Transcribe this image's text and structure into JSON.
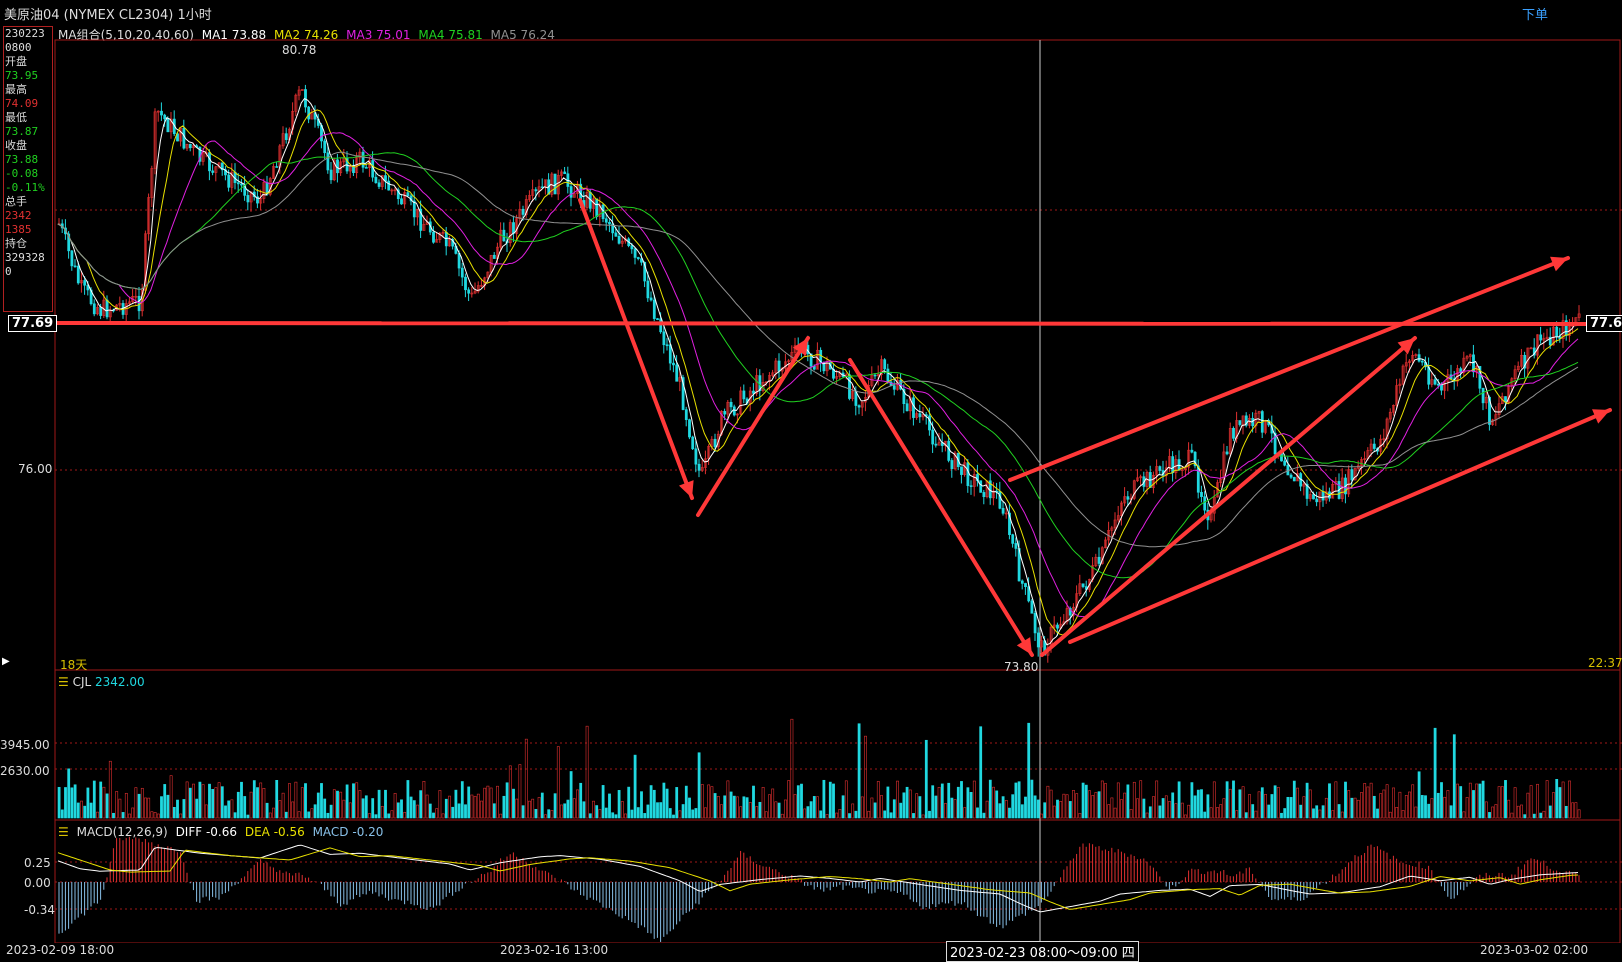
{
  "header": {
    "title": "美原油04 (NYMEX CL2304) 1小时",
    "order_button": "下单"
  },
  "info_panel": {
    "date": "230223",
    "time": "0800",
    "open_label": "开盘",
    "open_value": "73.95",
    "high_label": "最高",
    "high_value": "74.09",
    "low_label": "最低",
    "low_value": "73.87",
    "close_label": "收盘",
    "close_value": "73.88",
    "change": "-0.08",
    "change_pct": "-0.11%",
    "total_label": "总手",
    "total_value": "2342",
    "total_value2": "1385",
    "oi_label": "持仓",
    "oi_value": "329328",
    "oi_value2": "0"
  },
  "ma_legend": {
    "title": "MA组合(5,10,20,40,60)",
    "ma1": "MA1 73.88",
    "ma2": "MA2 74.26",
    "ma3": "MA3 75.01",
    "ma4": "MA4 75.81",
    "ma5": "MA5 76.24"
  },
  "colors": {
    "up": "#e03030",
    "down": "#20d8e0",
    "ma1": "#ffffff",
    "ma2": "#e8e000",
    "ma3": "#e020e0",
    "ma4": "#20d020",
    "ma5": "#909090",
    "annotation": "#ff3838",
    "grid": "#a01818"
  },
  "price_axis": {
    "current_price": "77.69",
    "level_76": "76.00",
    "high_marker": "80.78",
    "low_marker": "73.80"
  },
  "main_chart": {
    "period_label": "18天",
    "time_label": "22:37"
  },
  "volume": {
    "title": "CJL",
    "value": "2342.00",
    "axis_high": "3945.00",
    "axis_mid": "2630.00"
  },
  "macd": {
    "title": "MACD(12,26,9)",
    "diff": "DIFF -0.66",
    "dea": "DEA -0.56",
    "macd": "MACD -0.20",
    "axis_top": "0.25",
    "axis_zero": "0.00",
    "axis_bottom": "-0.34"
  },
  "dates": {
    "d1": "2023-02-09 18:00",
    "d2": "2023-02-16 13:00",
    "crosshair": "2023-02-23  08:00～09:00  四",
    "d4": "2023-03-02 02:00"
  },
  "chart_data": {
    "type": "candlestick",
    "title": "美原油04 (NYMEX CL2304) 1小时",
    "x_range": [
      "2023-02-09 18:00",
      "2023-03-02 22:37"
    ],
    "y_range": [
      73.8,
      80.78
    ],
    "series": [
      {
        "name": "MA1",
        "last": 73.88
      },
      {
        "name": "MA2",
        "last": 74.26
      },
      {
        "name": "MA3",
        "last": 75.01
      },
      {
        "name": "MA4",
        "last": 75.81
      },
      {
        "name": "MA5",
        "last": 76.24
      }
    ],
    "annotations": [
      "80.78",
      "73.80",
      "77.69"
    ]
  }
}
